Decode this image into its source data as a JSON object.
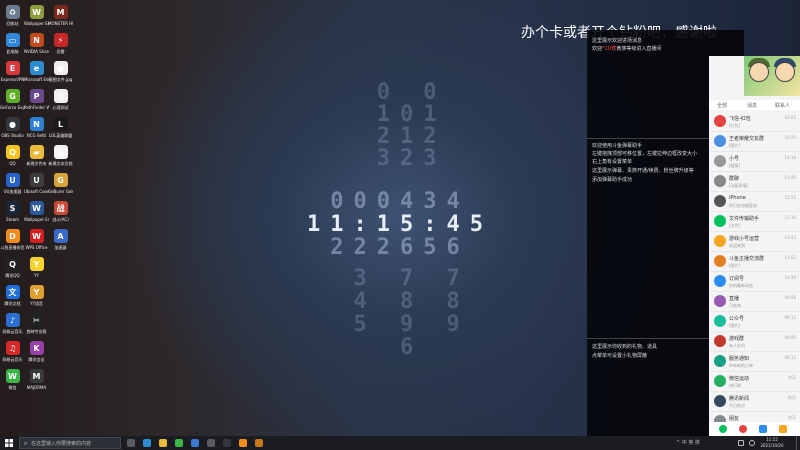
{
  "colors": {
    "accent": "#ff4a4a",
    "overlay_bg": "#05070b",
    "taskbar_bg": "#1a1c22",
    "chat_green": "#07c160"
  },
  "banner": {
    "text": "办个卡或者开个钻粉吧，感谢啦"
  },
  "clock": {
    "rows": [
      [
        " ",
        "0",
        " ",
        "0"
      ],
      [
        " ",
        "1",
        "0",
        "1"
      ],
      [
        " ",
        "2",
        "1",
        "2"
      ],
      [
        " ",
        "3",
        "2",
        "3"
      ],
      [
        "0",
        "0",
        "0",
        "4",
        "3",
        "4"
      ],
      [
        "1",
        "1",
        "1",
        "5",
        "4",
        "5"
      ],
      [
        "2",
        "2",
        "2",
        "6",
        "5",
        "6"
      ],
      [
        " ",
        "3",
        " ",
        "7",
        " ",
        "7"
      ],
      [
        " ",
        "4",
        " ",
        "8",
        " ",
        "8"
      ],
      [
        " ",
        "5",
        " ",
        "9",
        " ",
        "9"
      ],
      [
        " ",
        "6"
      ]
    ],
    "current_time": "11:15:45"
  },
  "overlay": {
    "line1": "这里展示欢迎进场消息",
    "line2_prefix": "欢迎",
    "line2_highlight": "*1U蕉",
    "line2_suffix": "黄族等级进入直播间",
    "block2": [
      "欢迎使用斗鱼弹幕助手",
      "左键拖拽顶部可移位置，左键拉伸边框改变大小",
      "右上角有设置菜单",
      "这里展示弹幕、贵族开通/续费、粉丝牌升级等",
      "添加弹幕助手成功"
    ],
    "block3": [
      "这里展示你收到的礼物、道具",
      "点菜单可设置小礼物屏蔽"
    ]
  },
  "chat": {
    "tabs": [
      "全部",
      "消息",
      "联系人"
    ],
    "items": [
      {
        "name": "飞信-红包",
        "msg": "[红包]",
        "time": "16:03",
        "color": "#e64340"
      },
      {
        "name": "王者荣耀交友群",
        "msg": "[图片]",
        "time": "15:20",
        "color": "#4a90e2"
      },
      {
        "name": "小号",
        "msg": "[链接]",
        "time": "14:18",
        "color": "#999999"
      },
      {
        "name": "群聊",
        "msg": "[动画表情]",
        "time": "13:40",
        "color": "#888888"
      },
      {
        "name": "iPhone",
        "msg": "你已在电脑登录",
        "time": "12:55",
        "color": "#555555"
      },
      {
        "name": "文件传输助手",
        "msg": "[文件]",
        "time": "12:10",
        "color": "#07c160"
      },
      {
        "name": "游戏小号运营",
        "msg": "欢迎来到",
        "time": "11:43",
        "color": "#f5a623"
      },
      {
        "name": "斗鱼主播交流群",
        "msg": "[图片]",
        "time": "11:02",
        "color": "#e67e22"
      },
      {
        "name": "订阅号",
        "msg": "你的最新动态",
        "time": "10:30",
        "color": "#2d8cf0"
      },
      {
        "name": "直播",
        "msg": "已结束",
        "time": "09:48",
        "color": "#9b59b6"
      },
      {
        "name": "公众号",
        "msg": "[图片]",
        "time": "09:15",
        "color": "#1abc9c"
      },
      {
        "name": "游戏群",
        "msg": "有人在吗",
        "time": "08:40",
        "color": "#c0392b"
      },
      {
        "name": "服务通知",
        "msg": "你有新的订单",
        "time": "08:12",
        "color": "#16a085"
      },
      {
        "name": "微信运动",
        "msg": "排行榜",
        "time": "昨天",
        "color": "#27ae60"
      },
      {
        "name": "腾讯新闻",
        "msg": "今日热点",
        "time": "昨天",
        "color": "#34495e"
      },
      {
        "name": "朋友",
        "msg": "好的",
        "time": "昨天",
        "color": "#7f8c8d"
      }
    ]
  },
  "desktop": {
    "icons": [
      {
        "label": "回收站",
        "icon": "recycle-bin-icon",
        "color": "#6a7d90",
        "glyph": "♻"
      },
      {
        "label": "此电脑",
        "icon": "computer-icon",
        "color": "#2f86d8",
        "glyph": "▭"
      },
      {
        "label": "ExpressVPN",
        "icon": "vpn-icon",
        "color": "#d8383a",
        "glyph": "E"
      },
      {
        "label": "GeForce Experience",
        "icon": "geforce-icon",
        "color": "#5fae26",
        "glyph": "G"
      },
      {
        "label": "OBS Studio",
        "icon": "obs-icon",
        "color": "#333840",
        "glyph": "●"
      },
      {
        "label": "QQ",
        "icon": "qq-icon",
        "color": "#f4c518",
        "glyph": "Q"
      },
      {
        "label": "UU加速器",
        "icon": "uu-icon",
        "color": "#2563c9",
        "glyph": "U"
      },
      {
        "label": "Steam",
        "icon": "steam-icon",
        "color": "#1b2838",
        "glyph": "S"
      },
      {
        "label": "斗鱼直播伴侣",
        "icon": "douyu-icon",
        "color": "#f08c1c",
        "glyph": "D"
      },
      {
        "label": "腾讯QQ",
        "icon": "tencent-qq-icon",
        "color": "#222222",
        "glyph": "Q"
      },
      {
        "label": "腾讯文档",
        "icon": "tencent-docs-icon",
        "color": "#1e6fd9",
        "glyph": "文"
      },
      {
        "label": "网易云音乐",
        "icon": "netease-music-icon",
        "color": "#2a6fd0",
        "glyph": "♪"
      },
      {
        "label": "网易云音乐",
        "icon": "music-icon",
        "color": "#d42a2a",
        "glyph": "♫"
      },
      {
        "label": "微信",
        "icon": "wechat-icon",
        "color": "#3bb54a",
        "glyph": "W"
      },
      {
        "label": "Wallpaper Engine",
        "icon": "wallpaper-engine-icon",
        "color": "#8a9d3a",
        "glyph": "W"
      },
      {
        "label": "NVIDIA Share",
        "icon": "nvidia-icon",
        "color": "#c24a1f",
        "glyph": "N"
      },
      {
        "label": "Microsoft Edge",
        "icon": "edge-icon",
        "color": "#2b8ccf",
        "glyph": "e"
      },
      {
        "label": "PathFinder Wreath",
        "icon": "game-icon",
        "color": "#6a4a8c",
        "glyph": "P"
      },
      {
        "label": "NCG Setti",
        "icon": "ncg-icon",
        "color": "#2c7fd1",
        "glyph": "N"
      },
      {
        "label": "新建文件夹",
        "icon": "folder-icon",
        "color": "#e8b93a",
        "glyph": "▰"
      },
      {
        "label": "Ubisoft Connect",
        "icon": "ubisoft-icon",
        "color": "#3c3c3c",
        "glyph": "U"
      },
      {
        "label": "Wallpaper Engine",
        "icon": "wallpaper-icon",
        "color": "#2a5a9c",
        "glyph": "W"
      },
      {
        "label": "WPS Office",
        "icon": "wps-icon",
        "color": "#d62020",
        "glyph": "W"
      },
      {
        "label": "YY",
        "icon": "yy-icon",
        "color": "#f7d12e",
        "glyph": "Y"
      },
      {
        "label": "YY语音",
        "icon": "yy-voice-icon",
        "color": "#e0a030",
        "glyph": "Y"
      },
      {
        "label": "剪映专业版",
        "icon": "capcut-icon",
        "color": "#222222",
        "glyph": "✂"
      },
      {
        "label": "腾讯会议",
        "icon": "meeting-icon",
        "color": "#9a3ea8",
        "glyph": "K"
      },
      {
        "label": "MAJORMA",
        "icon": "app-icon",
        "color": "#3a3a3a",
        "glyph": "M"
      },
      {
        "label": "MONSTER HUNTER",
        "icon": "monster-hunter-icon",
        "color": "#7a2a1a",
        "glyph": "M"
      },
      {
        "label": "迅雷",
        "icon": "thunder-icon",
        "color": "#c62828",
        "glyph": "⚡"
      },
      {
        "label": "截图文件.jpg",
        "icon": "image-file-icon",
        "color": "#eeeeee",
        "glyph": "●"
      },
      {
        "label": "心理测试",
        "icon": "test-icon",
        "color": "#f0f0f0",
        "glyph": "✿"
      },
      {
        "label": "LOL英雄联盟",
        "icon": "lol-icon",
        "color": "#1a1a1a",
        "glyph": "L"
      },
      {
        "label": "新建文本文档",
        "icon": "text-file-icon",
        "color": "#f5f5f5",
        "glyph": "≡"
      },
      {
        "label": "GeBurer Gold",
        "icon": "gold-icon",
        "color": "#d8a33a",
        "glyph": "G"
      },
      {
        "label": "战斗(AC)",
        "icon": "battle-icon",
        "color": "#c84a3a",
        "glyph": "战"
      },
      {
        "label": "加速器",
        "icon": "accelerator-icon",
        "color": "#3a6ac8",
        "glyph": "A"
      }
    ]
  },
  "taskbar": {
    "search_placeholder": "在这里输入你要搜索的内容",
    "pinned": [
      {
        "icon": "task-view-icon",
        "color": "#5a5c62"
      },
      {
        "icon": "edge-icon",
        "color": "#2b8ccf"
      },
      {
        "icon": "explorer-icon",
        "color": "#e8b93a"
      },
      {
        "icon": "wechat-icon",
        "color": "#3bb54a"
      },
      {
        "icon": "store-icon",
        "color": "#3a7ad6"
      },
      {
        "icon": "settings-icon",
        "color": "#5a5c62"
      },
      {
        "icon": "obs-icon",
        "color": "#333840"
      },
      {
        "icon": "douyu-icon",
        "color": "#f08c1c"
      },
      {
        "icon": "app-icon",
        "color": "#c7781a"
      }
    ],
    "tray": "^ 中 英 拼",
    "time": "11:15",
    "date": "2021/10/20"
  }
}
